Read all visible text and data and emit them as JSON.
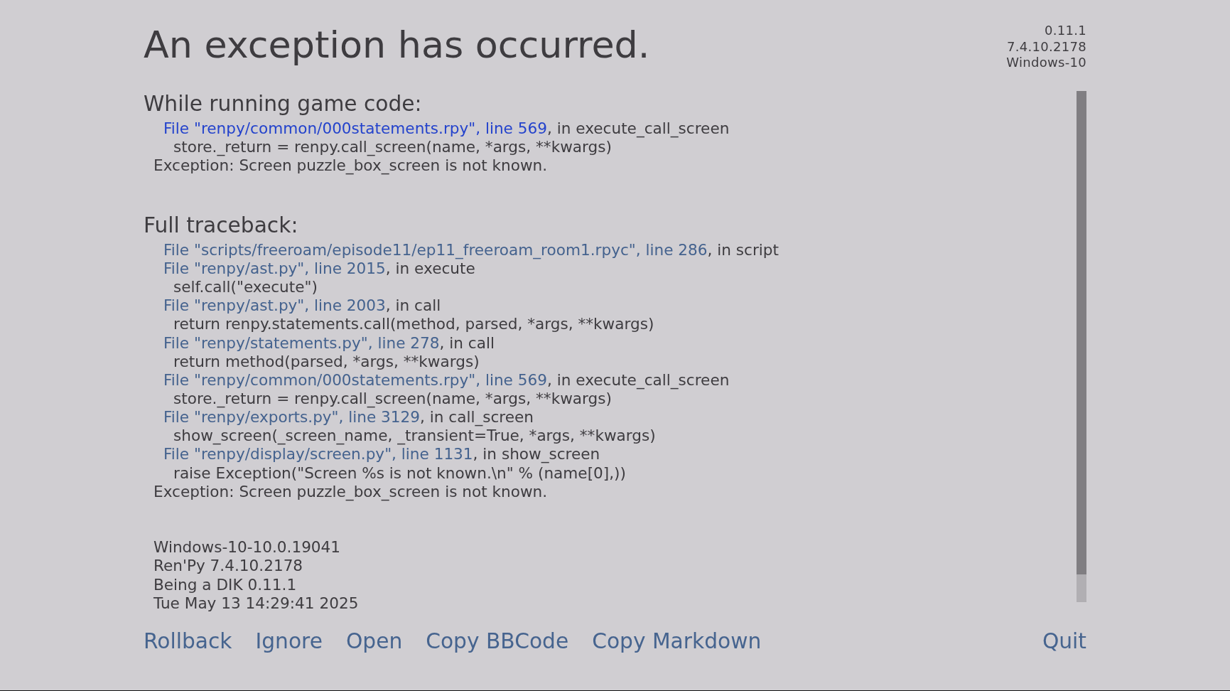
{
  "title": "An exception has occurred.",
  "version_info": [
    "0.11.1",
    "7.4.10.2178",
    "Windows-10"
  ],
  "sections": [
    {
      "heading": "While running game code:",
      "lines": [
        {
          "kind": "file",
          "link": "File \"renpy/common/000statements.rpy\", line 569",
          "text": ", in execute_call_screen",
          "focused": true
        },
        {
          "kind": "code",
          "text": "store._return = renpy.call_screen(name, *args, **kwargs)"
        },
        {
          "kind": "exception",
          "text": "Exception: Screen puzzle_box_screen is not known."
        }
      ]
    },
    {
      "heading": "Full traceback:",
      "lines": [
        {
          "kind": "file",
          "link": "File \"scripts/freeroam/episode11/ep11_freeroam_room1.rpyc\", line 286",
          "text": ", in script",
          "focused": false
        },
        {
          "kind": "file",
          "link": "File \"renpy/ast.py\", line 2015",
          "text": ", in execute",
          "focused": false
        },
        {
          "kind": "code",
          "text": "self.call(\"execute\")"
        },
        {
          "kind": "file",
          "link": "File \"renpy/ast.py\", line 2003",
          "text": ", in call",
          "focused": false
        },
        {
          "kind": "code",
          "text": "return renpy.statements.call(method, parsed, *args, **kwargs)"
        },
        {
          "kind": "file",
          "link": "File \"renpy/statements.py\", line 278",
          "text": ", in call",
          "focused": false
        },
        {
          "kind": "code",
          "text": "return method(parsed, *args, **kwargs)"
        },
        {
          "kind": "file",
          "link": "File \"renpy/common/000statements.rpy\", line 569",
          "text": ", in execute_call_screen",
          "focused": false
        },
        {
          "kind": "code",
          "text": "store._return = renpy.call_screen(name, *args, **kwargs)"
        },
        {
          "kind": "file",
          "link": "File \"renpy/exports.py\", line 3129",
          "text": ", in call_screen",
          "focused": false
        },
        {
          "kind": "code",
          "text": "show_screen(_screen_name, _transient=True, *args, **kwargs)"
        },
        {
          "kind": "file",
          "link": "File \"renpy/display/screen.py\", line 1131",
          "text": ", in show_screen",
          "focused": false
        },
        {
          "kind": "code",
          "text": "raise Exception(\"Screen %s is not known.\\n\" % (name[0],))"
        },
        {
          "kind": "exception",
          "text": "Exception: Screen puzzle_box_screen is not known."
        }
      ]
    }
  ],
  "system_info": [
    "Windows-10-10.0.19041",
    "Ren'Py 7.4.10.2178",
    "Being a DIK 0.11.1",
    "Tue May 13 14:29:41 2025"
  ],
  "buttons": [
    "Rollback",
    "Ignore",
    "Open",
    "Copy BBCode",
    "Copy Markdown"
  ],
  "quit_button": "Quit"
}
